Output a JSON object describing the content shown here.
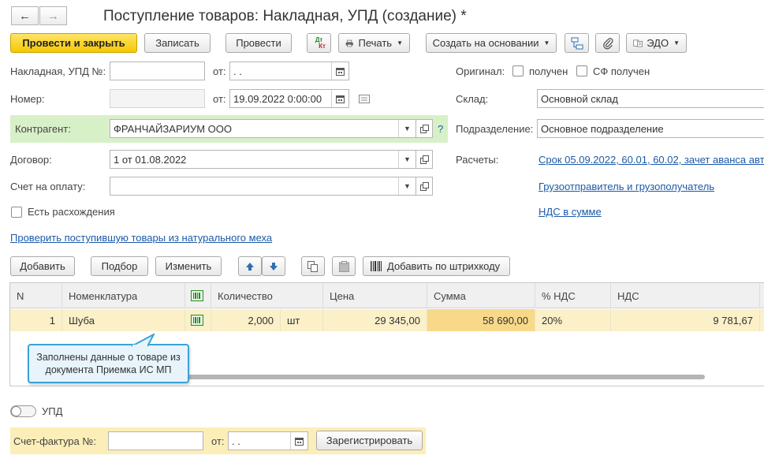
{
  "window": {
    "title": "Поступление товаров: Накладная, УПД (создание) *"
  },
  "nav": {
    "back": "←",
    "forward": "→"
  },
  "toolbar": {
    "post_close": "Провести и закрыть",
    "save": "Записать",
    "post": "Провести",
    "dtkt_top": "Дт",
    "dtkt_bottom": "Кт",
    "print": "Печать",
    "create_based": "Создать на основании",
    "edo": "ЭДО"
  },
  "form": {
    "invoice_label": "Накладная, УПД №:",
    "invoice_value": "",
    "from_label": "от:",
    "invoice_date": " .  .",
    "number_label": "Номер:",
    "number_value": "",
    "doc_date": "19.09.2022  0:00:00",
    "original_label": "Оригинал:",
    "received_label": "получен",
    "sf_received_label": "СФ получен",
    "warehouse_label": "Склад:",
    "warehouse_value": "Основной склад",
    "counterparty_label": "Контрагент:",
    "counterparty_value": "ФРАНЧАЙЗАРИУМ ООО",
    "help": "?",
    "division_label": "Подразделение:",
    "division_value": "Основное подразделение",
    "contract_label": "Договор:",
    "contract_value": "1 от 01.08.2022",
    "settlements_label": "Расчеты:",
    "settlements_link": "Срок 05.09.2022, 60.01, 60.02, зачет аванса авт",
    "payment_invoice_label": "Счет на оплату:",
    "payment_invoice_value": "",
    "shipper_link": "Грузоотправитель и грузополучатель",
    "discrepancies_label": "Есть расхождения",
    "vat_link": "НДС в сумме",
    "check_fur_link": "Проверить поступившую товары из натурального меха"
  },
  "table_toolbar": {
    "add": "Добавить",
    "pick": "Подбор",
    "edit": "Изменить",
    "add_barcode": "Добавить по штрихкоду"
  },
  "table": {
    "headers": {
      "n": "N",
      "item": "Номенклатура",
      "qty": "Количество",
      "price": "Цена",
      "sum": "Сумма",
      "vat_rate": "% НДС",
      "vat": "НДС"
    },
    "rows": [
      {
        "n": "1",
        "item": "Шуба",
        "qty": "2,000",
        "unit": "шт",
        "price": "29 345,00",
        "sum": "58 690,00",
        "vat_rate": "20%",
        "vat": "9 781,67"
      }
    ]
  },
  "tooltip": {
    "text": "Заполнены данные о товаре из документа Приемка ИС МП"
  },
  "footer": {
    "upd_label": "УПД",
    "sf_label": "Счет-фактура №:",
    "sf_value": "",
    "from_label": "от:",
    "sf_date": " .  .",
    "register": "Зарегистрировать"
  },
  "colors": {
    "primary_button": "#f5c800",
    "link": "#1c5aa8",
    "counterparty_bg": "#d8f0c8",
    "selected_row": "#fbf0c8",
    "footer_bg": "#fbeeb8",
    "tooltip_bg": "#e8f4fb",
    "tooltip_border": "#3aa3d8"
  }
}
